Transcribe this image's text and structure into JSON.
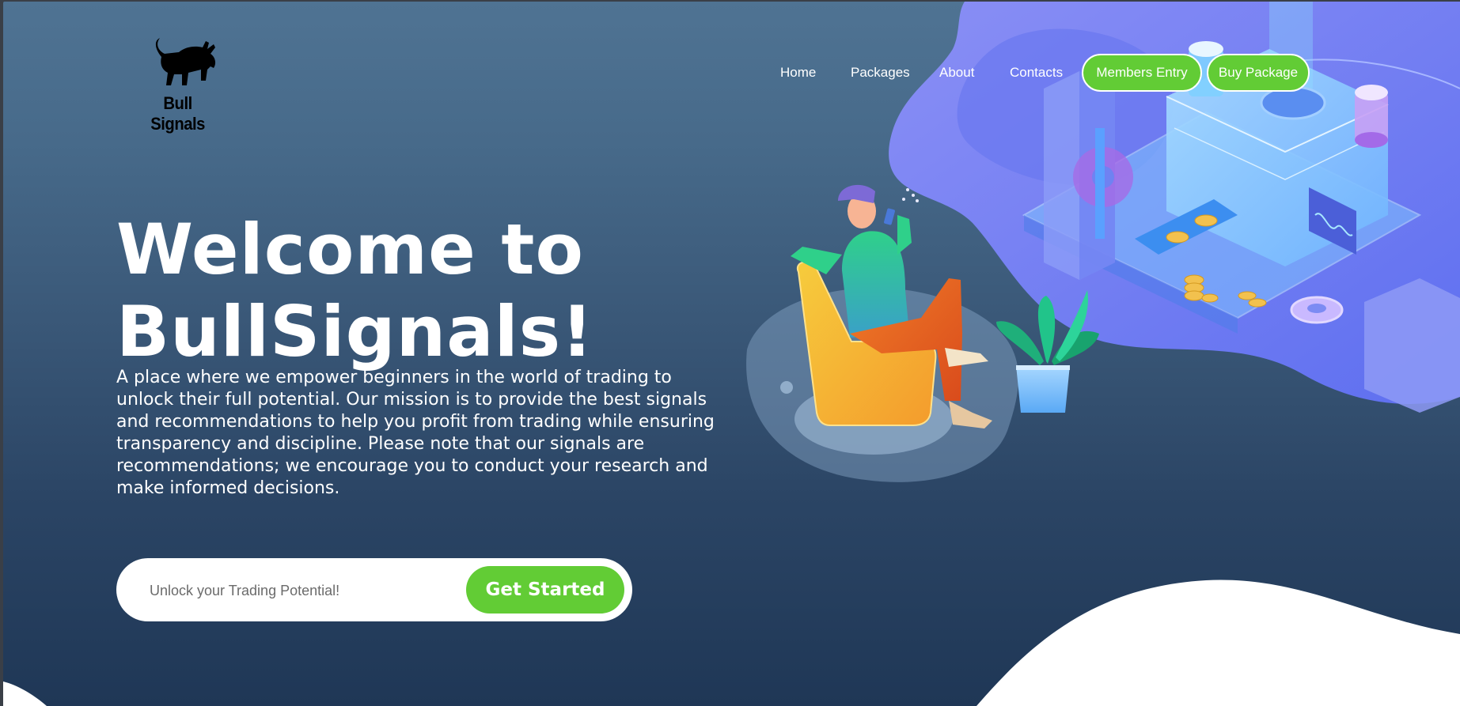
{
  "brand": {
    "name": "Bull Signals",
    "logo_icon": "bull-icon"
  },
  "nav": {
    "links": [
      "Home",
      "Packages",
      "About",
      "Contacts"
    ],
    "members_label": "Members Entry",
    "buy_label": "Buy Package"
  },
  "hero": {
    "title_line1": "Welcome to",
    "title_line2": "BullSignals!",
    "description": "A place where we empower beginners in the world of trading to unlock their full potential. Our mission is to provide the best signals and recommendations to help you profit from trading while ensuring transparency and discipline. Please note that our signals are recommendations; we encourage you to conduct your research and make informed decisions."
  },
  "cta": {
    "placeholder": "Unlock your Trading Potential!",
    "button_label": "Get Started"
  },
  "colors": {
    "accent": "#62cc35",
    "bg_top": "#4f7393",
    "bg_bottom": "#1f3756",
    "blob": "#6f7ff0"
  }
}
